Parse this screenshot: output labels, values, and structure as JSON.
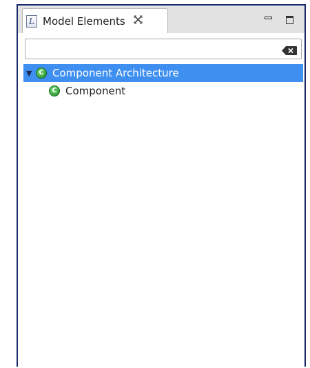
{
  "view": {
    "tab_label": "Model Elements",
    "tab_icon_letter": "L",
    "close_glyph": "✕",
    "filter": {
      "value": "",
      "placeholder": ""
    }
  },
  "tree": {
    "root": {
      "label": "Component Architecture",
      "icon": "class-icon",
      "icon_letter": "C",
      "expanded": true,
      "selected": true
    },
    "children": [
      {
        "label": "Component",
        "icon": "class-icon",
        "icon_letter": "C"
      }
    ]
  },
  "colors": {
    "selection": "#3e8ff0",
    "frame_border": "#1a2a6c",
    "icon_green": "#1f8f2a"
  }
}
